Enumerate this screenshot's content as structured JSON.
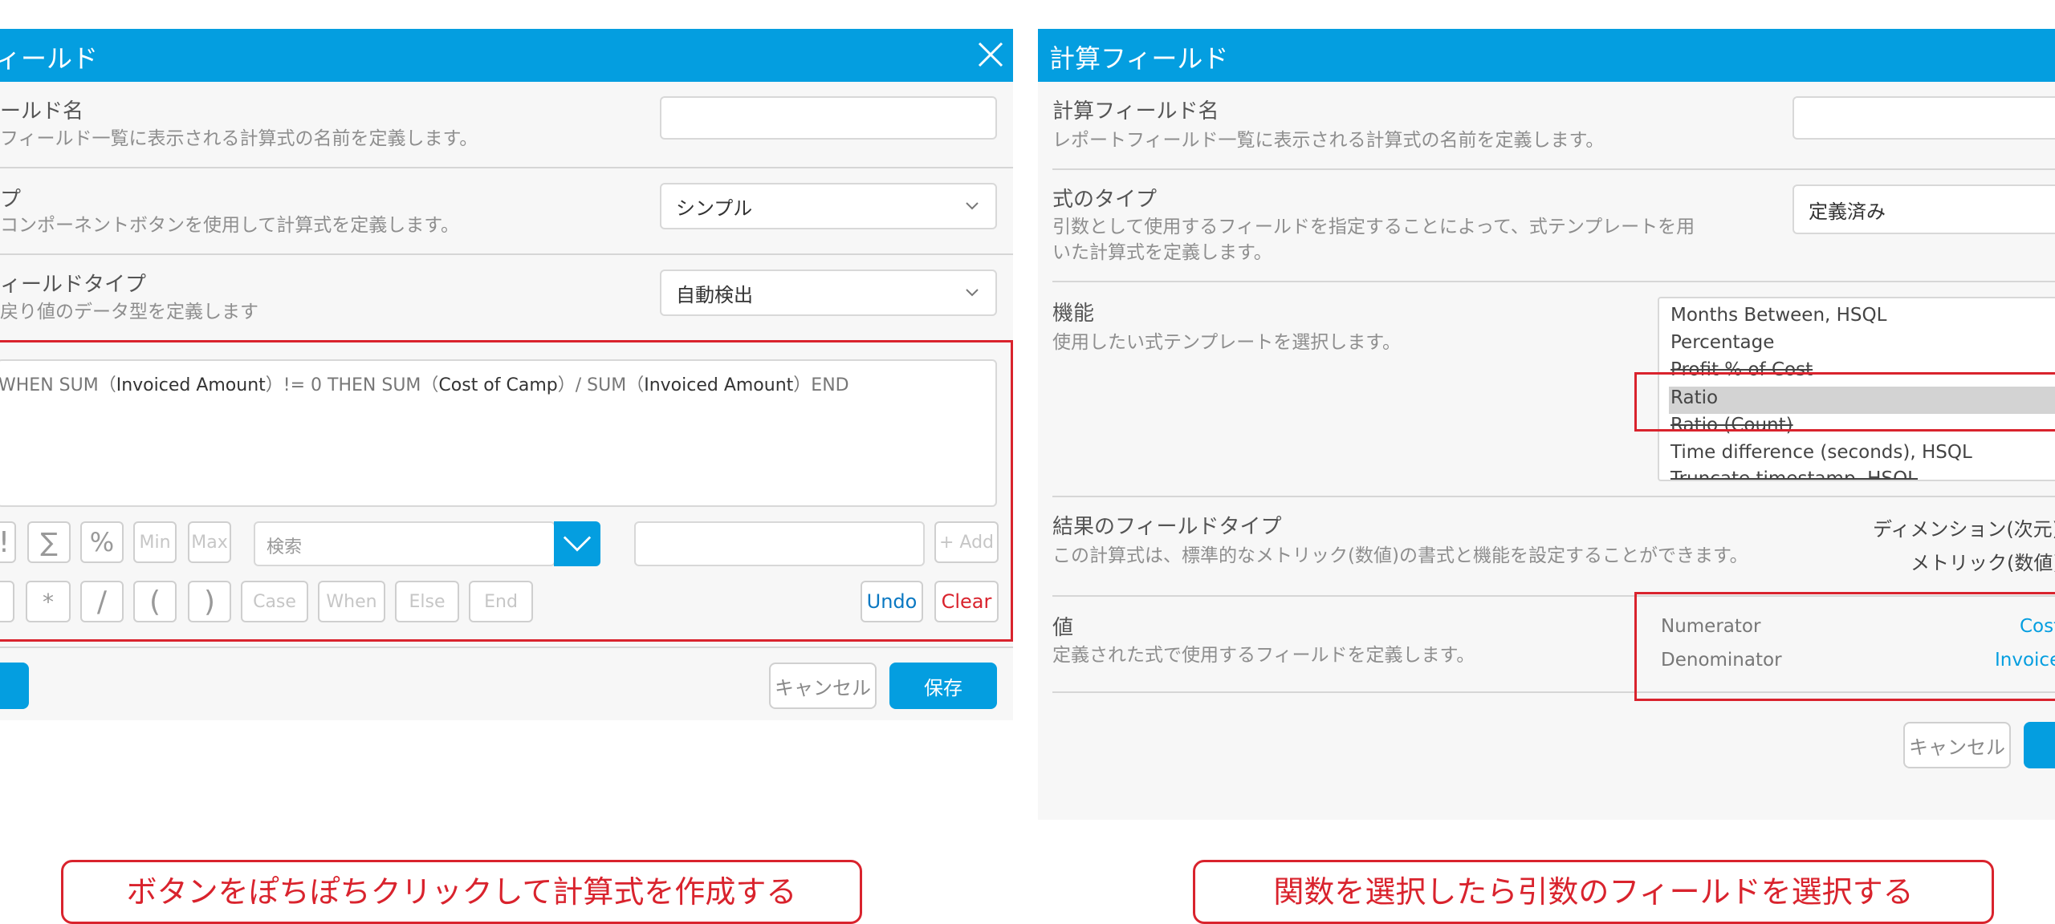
{
  "left": {
    "title": "ィールド",
    "field_name": {
      "label": "ールド名",
      "desc": "フィールド一覧に表示される計算式の名前を定義します。",
      "value": ""
    },
    "type": {
      "label": "プ",
      "desc": "コンポーネントボタンを使用して計算式を定義します。",
      "selected": "シンプル"
    },
    "field_type": {
      "label": "ィールドタイプ",
      "desc": "戻り値のデータ型を定義します",
      "selected": "自動検出"
    },
    "formula": {
      "parts": [
        {
          "text": "WHEN SUM（",
          "style": "kw"
        },
        {
          "text": "Invoiced Amount",
          "style": "field"
        },
        {
          "text": "）!= 0 THEN SUM（",
          "style": "kw"
        },
        {
          "text": "Cost of Camp",
          "style": "field"
        },
        {
          "text": "）/ SUM（",
          "style": "kw"
        },
        {
          "text": "Invoiced Amount",
          "style": "field"
        },
        {
          "text": "）END",
          "style": "kw"
        }
      ]
    },
    "row1_buttons": [
      "!",
      "∑",
      "%",
      "Min",
      "Max"
    ],
    "search_placeholder": "検索",
    "add_label": "+ Add",
    "row2_buttons": [
      "*",
      "/",
      "(",
      ")",
      "Case",
      "When",
      "Else",
      "End"
    ],
    "undo_label": "Undo",
    "clear_label": "Clear",
    "cancel_label": "キャンセル",
    "save_label": "保存"
  },
  "right": {
    "title": "計算フィールド",
    "field_name": {
      "label": "計算フィールド名",
      "desc": "レポートフィールド一覧に表示される計算式の名前を定義します。",
      "value": ""
    },
    "formula_type": {
      "label": "式のタイプ",
      "desc1": "引数として使用するフィールドを指定することによって、式テンプレートを用",
      "desc2": "いた計算式を定義します。",
      "selected": "定義済み"
    },
    "function": {
      "label": "機能",
      "desc": "使用したい式テンプレートを選択します。",
      "items": [
        "Months Between, HSQL",
        "Percentage",
        "Profit % of Cost",
        "Ratio",
        "Ratio (Count)",
        "Time difference (seconds), HSQL",
        "Truncate timestamp, HSQL"
      ],
      "selected_index": 3
    },
    "result_type": {
      "label": "結果のフィールドタイプ",
      "desc": "この計算式は、標準的なメトリック(数値)の書式と機能を設定することができます。",
      "opt1": "ディメンション(次元)",
      "opt2": "メトリック(数値)"
    },
    "values": {
      "label": "値",
      "desc": "定義された式で使用するフィールドを定義します。",
      "rows": [
        {
          "key": "Numerator",
          "value": "Cost"
        },
        {
          "key": "Denominator",
          "value": "Invoice"
        }
      ]
    },
    "cancel_label": "キャンセル"
  },
  "annotations": {
    "left": "ボタンをぽちぽちクリックして計算式を作成する",
    "right": "関数を選択したら引数のフィールドを選択する"
  },
  "colors": {
    "accent": "#049ee0",
    "annotation": "#d9232d",
    "panel": "#f7f7f7"
  }
}
